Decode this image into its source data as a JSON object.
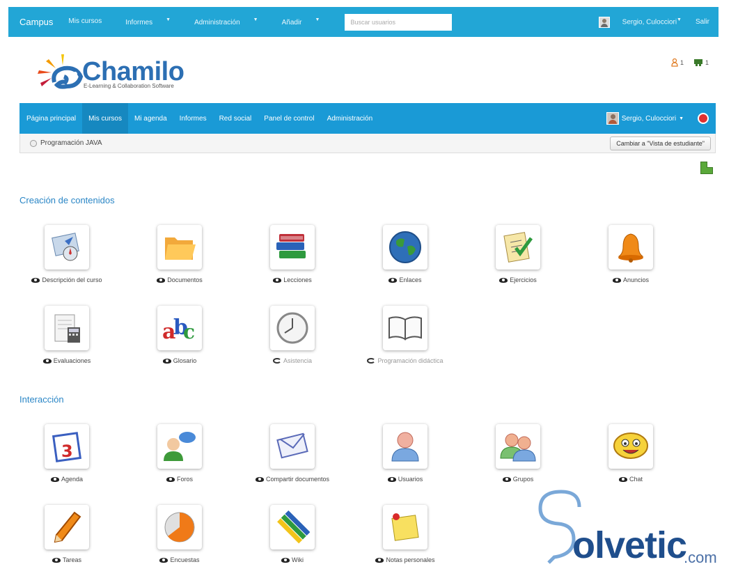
{
  "topbar": {
    "brand": "Campus",
    "nav": [
      {
        "label": "Mis cursos",
        "caret": false
      },
      {
        "label": "Informes",
        "caret": true
      },
      {
        "label": "Administración",
        "caret": true
      },
      {
        "label": "Añadir",
        "caret": true
      }
    ],
    "search_placeholder": "Buscar usuarios",
    "user": "Sergio, Culocciori",
    "logout": "Salir",
    "accent": "#22a6d6"
  },
  "logo": {
    "word": "Chamilo",
    "tagline": "E-Learning & Collaboration Software"
  },
  "header_icons": {
    "users_count": "1",
    "chat_count": "1"
  },
  "mainnav": {
    "items": [
      "Página principal",
      "Mis cursos",
      "Mi agenda",
      "Informes",
      "Red social",
      "Panel de control",
      "Administración"
    ],
    "active_index": 1,
    "user": "Sergio, Culocciori",
    "color": "#1a9ad6"
  },
  "breadcrumb": {
    "course": "Programación JAVA",
    "switch_button": "Cambiar a \"Vista de estudiante\""
  },
  "sections": {
    "content": {
      "title": "Creación de contenidos",
      "tools": [
        {
          "label": "Descripción del curso",
          "icon": "course-description-icon",
          "visible": true
        },
        {
          "label": "Documentos",
          "icon": "folder-icon",
          "visible": true
        },
        {
          "label": "Lecciones",
          "icon": "books-icon",
          "visible": true
        },
        {
          "label": "Enlaces",
          "icon": "globe-icon",
          "visible": true
        },
        {
          "label": "Ejercicios",
          "icon": "checklist-icon",
          "visible": true
        },
        {
          "label": "Anuncios",
          "icon": "bell-icon",
          "visible": true
        },
        {
          "label": "Evaluaciones",
          "icon": "gradebook-icon",
          "visible": true
        },
        {
          "label": "Glosario",
          "icon": "abc-icon",
          "visible": true
        },
        {
          "label": "Asistencia",
          "icon": "clock-icon",
          "visible": false
        },
        {
          "label": "Programación didáctica",
          "icon": "open-book-icon",
          "visible": false
        }
      ]
    },
    "interaction": {
      "title": "Interacción",
      "tools": [
        {
          "label": "Agenda",
          "icon": "calendar-icon",
          "visible": true
        },
        {
          "label": "Foros",
          "icon": "forum-icon",
          "visible": true
        },
        {
          "label": "Compartir documentos",
          "icon": "envelope-icon",
          "visible": true
        },
        {
          "label": "Usuarios",
          "icon": "user-icon",
          "visible": true
        },
        {
          "label": "Grupos",
          "icon": "group-icon",
          "visible": true
        },
        {
          "label": "Chat",
          "icon": "smiley-icon",
          "visible": true
        },
        {
          "label": "Tareas",
          "icon": "pencil-icon",
          "visible": true
        },
        {
          "label": "Encuestas",
          "icon": "survey-icon",
          "visible": true
        },
        {
          "label": "Wiki",
          "icon": "wiki-pencils-icon",
          "visible": true
        },
        {
          "label": "Notas personales",
          "icon": "sticky-note-icon",
          "visible": true
        }
      ]
    }
  },
  "watermark": {
    "word": "olvetic",
    "suffix": ".com"
  }
}
